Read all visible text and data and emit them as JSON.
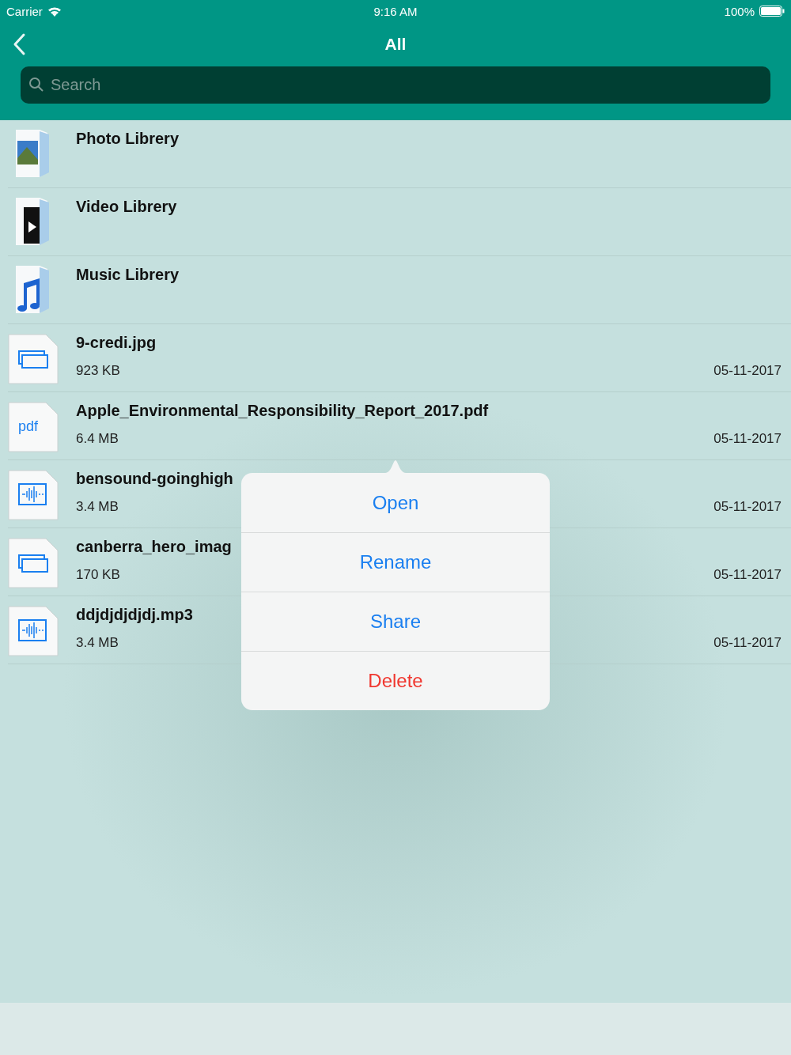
{
  "status_bar": {
    "carrier": "Carrier",
    "time": "9:16 AM",
    "battery": "100%"
  },
  "nav": {
    "title": "All"
  },
  "search": {
    "placeholder": "Search"
  },
  "rows": [
    {
      "kind": "photo-library",
      "name": "Photo Librery"
    },
    {
      "kind": "video-library",
      "name": "Video Librery"
    },
    {
      "kind": "music-library",
      "name": "Music Librery"
    },
    {
      "kind": "image",
      "name": "9-credi.jpg",
      "size": "923 KB",
      "date": "05-11-2017"
    },
    {
      "kind": "pdf",
      "icon_label": "pdf",
      "name": "Apple_Environmental_Responsibility_Report_2017.pdf",
      "size": "6.4 MB",
      "date": "05-11-2017"
    },
    {
      "kind": "audio",
      "name": "bensound-goinghigh",
      "size": "3.4 MB",
      "date": "05-11-2017"
    },
    {
      "kind": "image",
      "name": "canberra_hero_imag",
      "size": "170 KB",
      "date": "05-11-2017"
    },
    {
      "kind": "audio",
      "name": "ddjdjdjdjdj.mp3",
      "size": "3.4 MB",
      "date": "05-11-2017"
    }
  ],
  "popover": {
    "actions": [
      {
        "label": "Open",
        "kind": "default"
      },
      {
        "label": "Rename",
        "kind": "default"
      },
      {
        "label": "Share",
        "kind": "default"
      },
      {
        "label": "Delete",
        "kind": "destructive"
      }
    ]
  }
}
